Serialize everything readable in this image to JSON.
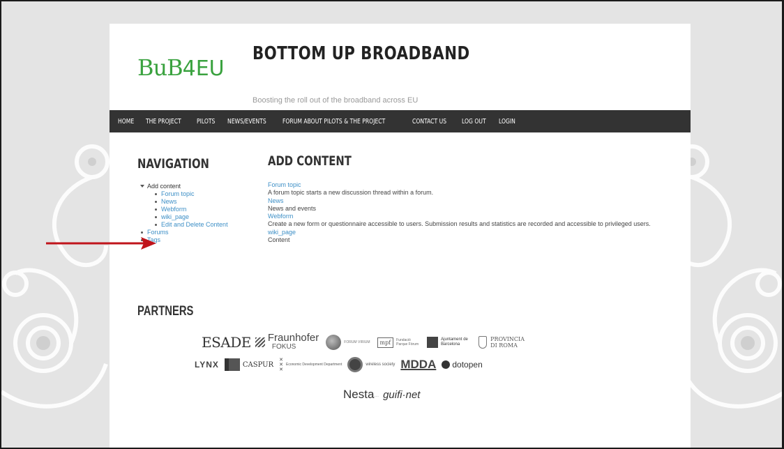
{
  "site": {
    "logo_main": "BuB",
    "logo_eu": "4EU",
    "title": "BOTTOM UP BROADBAND",
    "slogan": "Boosting the roll out of the broadband across EU"
  },
  "menu": [
    "HOME",
    "THE PROJECT",
    "PILOTS",
    "NEWS/EVENTS",
    "FORUM ABOUT PILOTS & THE PROJECT",
    "CONTACT US",
    "LOG OUT",
    "LOGIN"
  ],
  "navigation": {
    "title": "NAVIGATION",
    "add_content": "Add content",
    "sub_items": [
      "Forum topic",
      "News",
      "Webform",
      "wiki_page",
      "Edit and Delete Content"
    ],
    "forums": "Forums",
    "tags": "Tags"
  },
  "content": {
    "title": "ADD CONTENT",
    "items": [
      {
        "link": "Forum topic",
        "desc": "A forum topic starts a new discussion thread within a forum."
      },
      {
        "link": "News",
        "desc": "News and events"
      },
      {
        "link": "Webform",
        "desc": "Create a new form or questionnaire accessible to users. Submission results and statistics are recorded and accessible to privileged users."
      },
      {
        "link": "wiki_page",
        "desc": "Content"
      }
    ]
  },
  "partners": {
    "title": "PARTNERS",
    "row1": [
      "ESADE",
      "Fraunhofer",
      "FOKUS",
      "FORUM VIRIUM",
      "Fundació Parque Fòrum",
      "Ajuntament de Barcelona",
      "PROVINCIA DI ROMA"
    ],
    "row2": [
      "LYNX",
      "CASPUR",
      "Economic Development Department",
      "wireless society",
      "MDDA",
      "dotopen"
    ],
    "row3": [
      "Nesta",
      "guifi·net"
    ]
  },
  "colors": {
    "accent_green": "#3aa23f",
    "menu_bg": "#333333",
    "link_blue": "#3d8fc6",
    "arrow_red": "#c0141b"
  }
}
